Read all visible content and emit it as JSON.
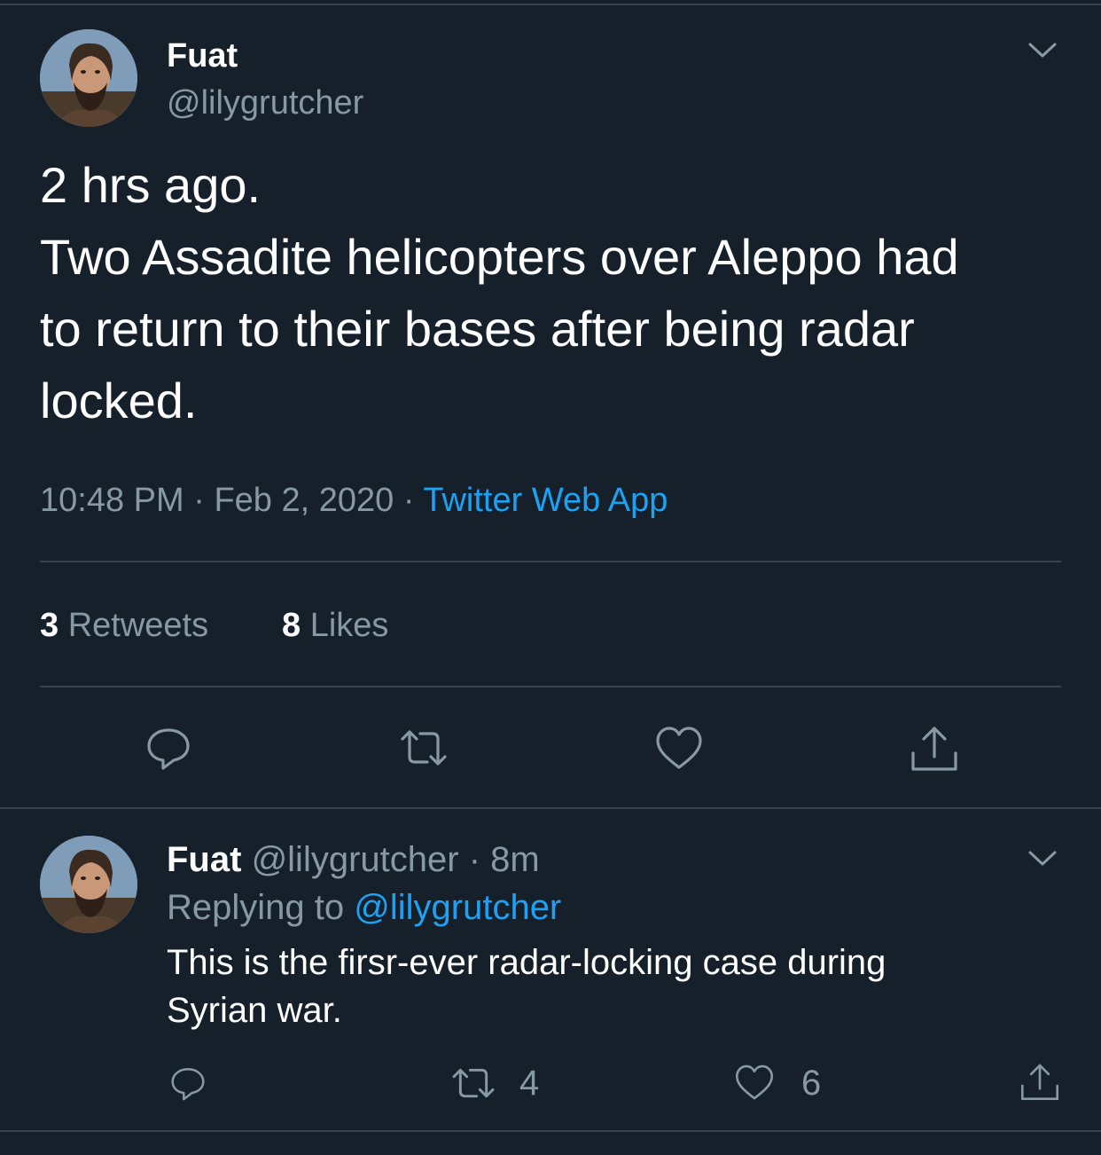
{
  "main_tweet": {
    "author_name": "Fuat",
    "author_handle": "@lilygrutcher",
    "text_lines": [
      "2 hrs ago.",
      "Two Assadite helicopters over Aleppo had",
      "to return to their bases after being radar",
      "locked."
    ],
    "time": "10:48 PM",
    "date": "Feb 2, 2020",
    "separator": "·",
    "source": "Twitter Web App",
    "retweets_count": "3",
    "retweets_label": "Retweets",
    "likes_count": "8",
    "likes_label": "Likes",
    "actions": [
      "reply-icon",
      "retweet-icon",
      "like-icon",
      "share-icon"
    ]
  },
  "reply_tweet": {
    "author_name": "Fuat",
    "author_handle": "@lilygrutcher",
    "separator": "·",
    "time_ago": "8m",
    "replying_to_label": "Replying to",
    "replying_to_handle": "@lilygrutcher",
    "text_lines": [
      "This is the firsr-ever radar-locking case during",
      "Syrian war."
    ],
    "retweet_count": "4",
    "like_count": "6"
  },
  "colors": {
    "background": "#15202b",
    "text_primary": "#ffffff",
    "text_secondary": "#8899a6",
    "link": "#1da1f2",
    "divider": "#38444d"
  }
}
